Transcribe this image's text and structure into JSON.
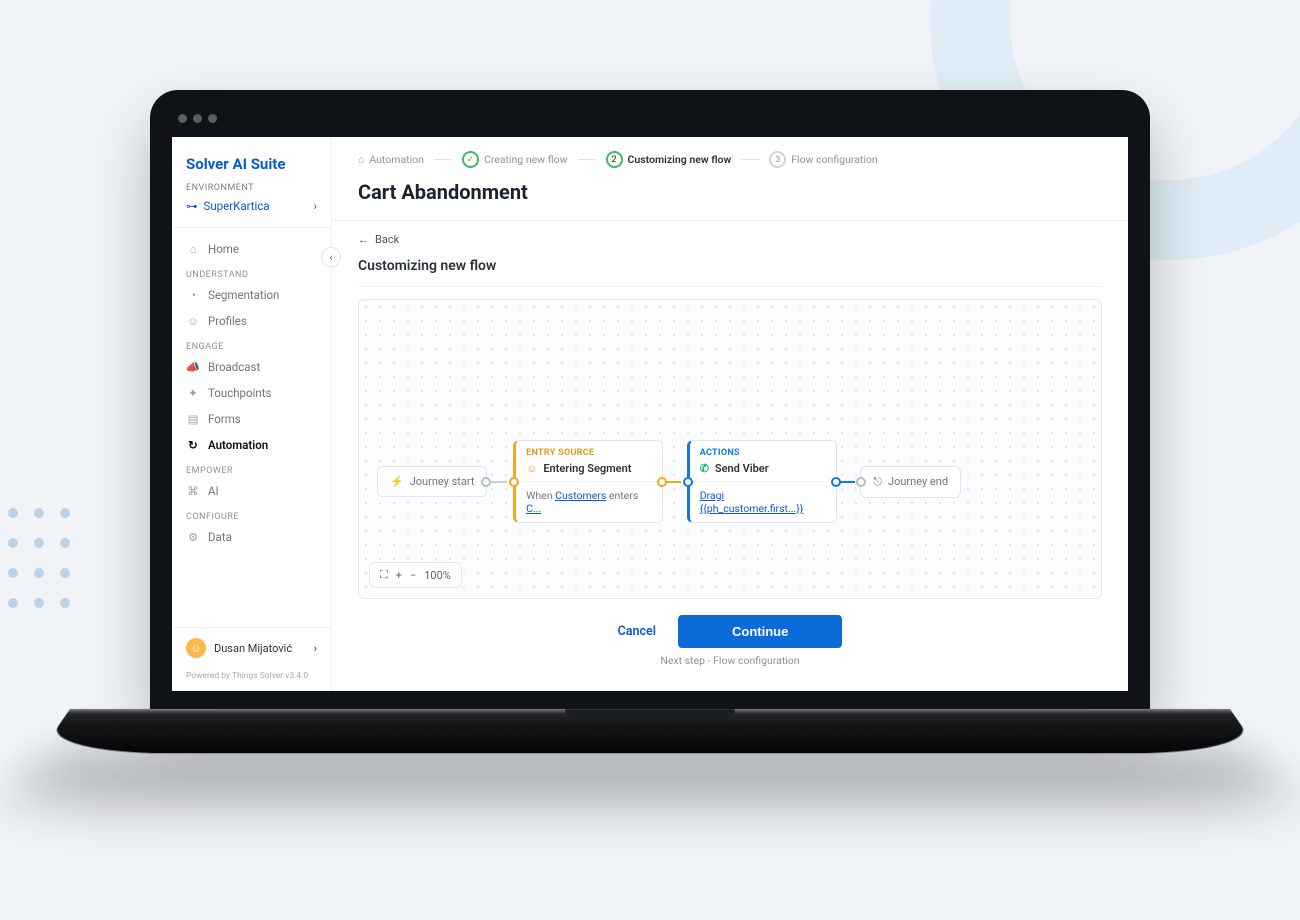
{
  "brand": "Solver AI Suite",
  "environment": {
    "label": "ENVIRONMENT",
    "name": "SuperKartica"
  },
  "sidebar": {
    "home": "Home",
    "sections": {
      "understand": "UNDERSTAND",
      "engage": "ENGAGE",
      "empower": "EMPOWER",
      "configure": "CONFIGURE"
    },
    "items": {
      "segmentation": "Segmentation",
      "profiles": "Profiles",
      "broadcast": "Broadcast",
      "touchpoints": "Touchpoints",
      "forms": "Forms",
      "automation": "Automation",
      "ai": "AI",
      "data": "Data"
    }
  },
  "user": {
    "name": "Dusan Mijatović"
  },
  "powered": "Powered by Things Solver v3.4.0",
  "breadcrumbs": {
    "root": "Automation",
    "step1": "Creating new flow",
    "step2_num": "2",
    "step2": "Customizing new flow",
    "step3_num": "3",
    "step3": "Flow configuration"
  },
  "page": {
    "title": "Cart Abandonment",
    "back": "Back",
    "subtitle": "Customizing new flow"
  },
  "flow": {
    "journey_start": "Journey start",
    "journey_end": "Journey end",
    "entry": {
      "header": "ENTRY SOURCE",
      "title": "Entering Segment",
      "body_pre": "When ",
      "body_link1": "Customers",
      "body_mid": " enters ",
      "body_link2": "C..."
    },
    "action": {
      "header": "ACTIONS",
      "title": "Send Viber",
      "body_link": "Dragi {{ph_customer.first...}}"
    }
  },
  "zoom": {
    "level": "100%"
  },
  "footer": {
    "cancel": "Cancel",
    "continue": "Continue",
    "hint": "Next step - Flow configuration"
  }
}
